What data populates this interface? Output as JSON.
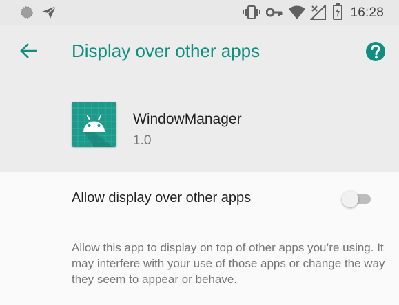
{
  "status_bar": {
    "time": "16:28",
    "icons": [
      "notification-dot-icon",
      "send-icon",
      "vibrate-icon",
      "vpn-key-icon",
      "wifi-icon",
      "no-signal-icon",
      "battery-charging-icon"
    ]
  },
  "app_bar": {
    "title": "Display over other apps",
    "back_icon": "arrow-back-icon",
    "help_icon": "help-icon"
  },
  "app": {
    "name": "WindowManager",
    "version": "1.0",
    "icon": "android-robot-icon"
  },
  "setting": {
    "label": "Allow display over other apps",
    "enabled": false,
    "summary": "Allow this app to display on top of other apps you’re using. It may interfere with your use of those apps or change the way they seem to appear or behave."
  },
  "colors": {
    "accent": "#0f8f80",
    "header_bg": "#ececec",
    "status_bar_bg": "#e8e8e8",
    "content_bg": "#fafafa"
  }
}
